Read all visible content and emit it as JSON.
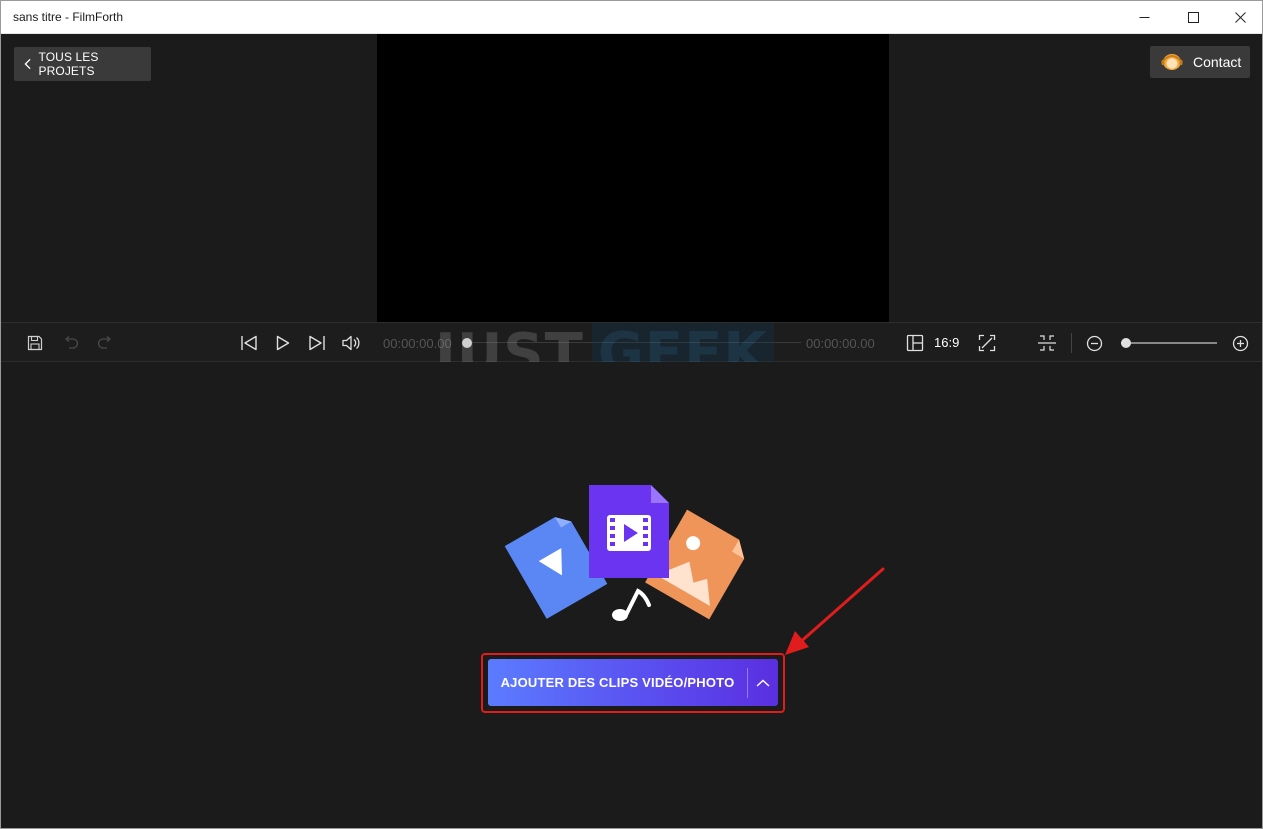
{
  "window": {
    "title": "sans titre - FilmForth"
  },
  "titlebar": {
    "icons": [
      "minimize-icon",
      "maximize-icon",
      "close-icon"
    ]
  },
  "preview": {
    "back_label": "TOUS LES PROJETS",
    "contact_label": "Contact"
  },
  "controls": {
    "current_time": "00:00:00.00",
    "total_time": "00:00:00.00",
    "aspect_ratio": "16:9",
    "progress": 0,
    "zoom_level": 0.05,
    "icons": [
      "save-icon",
      "undo-icon",
      "redo-icon",
      "skip-back-icon",
      "play-icon",
      "skip-forward-icon",
      "volume-icon",
      "aspect-ratio-icon",
      "fullscreen-icon",
      "split-icon",
      "zoom-out-icon",
      "zoom-in-icon"
    ]
  },
  "watermark": {
    "part1": "JUST",
    "part2": "GEEK"
  },
  "timeline": {
    "add_clips_label": "AJOUTER DES CLIPS VIDÉO/PHOTO",
    "illustration_icons": [
      "video-file-icon",
      "play-file-icon",
      "image-file-icon",
      "music-note-icon"
    ]
  },
  "colors": {
    "accent_start": "#5b7cff",
    "accent_end": "#5a2fe0",
    "annotation_red": "#e01c1c",
    "panel_bg": "#1b1b1b"
  }
}
